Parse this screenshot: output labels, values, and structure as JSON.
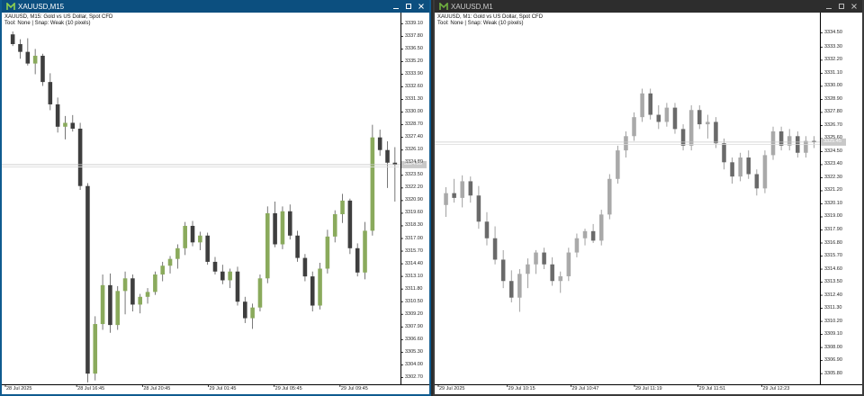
{
  "windows": [
    {
      "id": "left",
      "title": "XAUUSD,M15",
      "symbol_line": "XAUUSD, M15:  Gold vs US Dollar, Spot CFD",
      "tool_line": "Tool: None | Snap: Weak (10 pixels)",
      "active": true,
      "colors": {
        "up": "#8aaa5c",
        "down": "#3e3e3e",
        "wick": "#555555"
      },
      "current_price_label": "3324.55",
      "chart_data": {
        "type": "candlestick",
        "y_ticks": [
          "3339.10",
          "3337.80",
          "3336.50",
          "3335.20",
          "3333.90",
          "3332.60",
          "3331.30",
          "3330.00",
          "3328.70",
          "3327.40",
          "3326.10",
          "3324.80",
          "3323.50",
          "3322.20",
          "3320.90",
          "3319.60",
          "3318.30",
          "3317.00",
          "3315.70",
          "3314.40",
          "3313.10",
          "3311.80",
          "3310.50",
          "3309.20",
          "3307.90",
          "3306.60",
          "3305.30",
          "3304.00",
          "3302.70"
        ],
        "ylim": [
          3302.0,
          3339.5
        ],
        "x_ticks": [
          "28 Jul 2025",
          "28 Jul 16:45",
          "28 Jul 20:45",
          "29 Jul 01:45",
          "29 Jul 05:45",
          "29 Jul 09:45"
        ],
        "current_price": 3324.6,
        "candles": [
          [
            3338.0,
            3338.3,
            3336.8,
            3337.0
          ],
          [
            3337.0,
            3337.5,
            3335.5,
            3336.2
          ],
          [
            3336.2,
            3337.6,
            3334.8,
            3335.0
          ],
          [
            3335.0,
            3336.5,
            3333.9,
            3335.8
          ],
          [
            3335.8,
            3336.0,
            3332.7,
            3333.1
          ],
          [
            3333.1,
            3334.0,
            3330.2,
            3330.8
          ],
          [
            3330.8,
            3331.5,
            3327.9,
            3328.5
          ],
          [
            3328.5,
            3329.6,
            3327.2,
            3328.9
          ],
          [
            3328.9,
            3329.7,
            3328.0,
            3328.3
          ],
          [
            3328.3,
            3328.9,
            3322.0,
            3322.4
          ],
          [
            3322.4,
            3322.7,
            3302.2,
            3303.1
          ],
          [
            3303.1,
            3309.0,
            3302.4,
            3308.2
          ],
          [
            3308.2,
            3313.3,
            3307.6,
            3312.2
          ],
          [
            3312.2,
            3313.4,
            3307.3,
            3308.1
          ],
          [
            3308.1,
            3312.1,
            3307.6,
            3311.6
          ],
          [
            3311.6,
            3313.6,
            3309.2,
            3312.9
          ],
          [
            3312.9,
            3313.3,
            3309.5,
            3310.2
          ],
          [
            3310.2,
            3311.3,
            3309.3,
            3311.0
          ],
          [
            3311.0,
            3311.9,
            3310.3,
            3311.5
          ],
          [
            3311.5,
            3313.6,
            3311.2,
            3313.3
          ],
          [
            3313.3,
            3314.6,
            3312.6,
            3314.2
          ],
          [
            3314.2,
            3315.2,
            3313.4,
            3314.9
          ],
          [
            3314.9,
            3316.4,
            3313.9,
            3316.0
          ],
          [
            3316.0,
            3318.7,
            3315.3,
            3318.3
          ],
          [
            3318.3,
            3318.8,
            3316.2,
            3316.6
          ],
          [
            3316.6,
            3317.7,
            3315.8,
            3317.3
          ],
          [
            3317.3,
            3317.6,
            3314.3,
            3314.6
          ],
          [
            3314.6,
            3315.1,
            3313.3,
            3313.6
          ],
          [
            3313.6,
            3314.3,
            3312.3,
            3312.7
          ],
          [
            3312.7,
            3313.9,
            3311.9,
            3313.6
          ],
          [
            3313.6,
            3314.1,
            3310.1,
            3310.5
          ],
          [
            3310.5,
            3311.0,
            3308.3,
            3308.8
          ],
          [
            3308.8,
            3310.3,
            3307.7,
            3309.9
          ],
          [
            3309.9,
            3313.3,
            3309.5,
            3312.9
          ],
          [
            3312.9,
            3320.3,
            3312.4,
            3319.6
          ],
          [
            3319.6,
            3320.8,
            3316.1,
            3316.4
          ],
          [
            3316.4,
            3320.3,
            3315.9,
            3319.8
          ],
          [
            3319.8,
            3320.5,
            3316.9,
            3317.3
          ],
          [
            3317.3,
            3317.8,
            3314.6,
            3315.0
          ],
          [
            3315.0,
            3315.4,
            3312.6,
            3313.1
          ],
          [
            3313.1,
            3313.6,
            3309.5,
            3310.1
          ],
          [
            3310.1,
            3314.5,
            3309.7,
            3313.9
          ],
          [
            3313.9,
            3317.9,
            3313.4,
            3317.2
          ],
          [
            3317.2,
            3319.9,
            3316.6,
            3319.5
          ],
          [
            3319.5,
            3321.6,
            3318.6,
            3320.9
          ],
          [
            3320.9,
            3321.1,
            3315.4,
            3316.0
          ],
          [
            3316.0,
            3316.5,
            3313.1,
            3313.5
          ],
          [
            3313.5,
            3318.7,
            3312.8,
            3317.8
          ],
          [
            3317.8,
            3328.7,
            3317.3,
            3327.4
          ],
          [
            3327.4,
            3328.2,
            3325.5,
            3326.1
          ],
          [
            3326.1,
            3327.0,
            3322.2,
            3324.8
          ],
          [
            3324.8,
            3326.4,
            3320.8,
            3324.6
          ]
        ]
      }
    },
    {
      "id": "right",
      "title": "XAUUSD,M1",
      "symbol_line": "XAUUSD, M1:  Gold vs US Dollar, Spot CFD",
      "tool_line": "Tool: None | Snap: Weak (10 pixels)",
      "active": false,
      "colors": {
        "up": "#a9a9a9",
        "down": "#6a6a6a",
        "wick": "#8a8a8a"
      },
      "current_price_label": "3325.45",
      "chart_data": {
        "type": "candlestick",
        "y_ticks": [
          "3334.50",
          "3333.30",
          "3332.20",
          "3331.10",
          "3330.00",
          "3328.90",
          "3327.80",
          "3326.70",
          "3325.60",
          "3324.50",
          "3323.40",
          "3322.30",
          "3321.20",
          "3320.10",
          "3319.00",
          "3317.90",
          "3316.80",
          "3315.70",
          "3314.60",
          "3313.50",
          "3312.40",
          "3311.30",
          "3310.20",
          "3309.10",
          "3308.00",
          "3306.90",
          "3305.80"
        ],
        "ylim": [
          3304.9,
          3335.6
        ],
        "x_ticks": [
          "29 Jul 2025",
          "29 Jul 10:15",
          "29 Jul 10:47",
          "29 Jul 11:19",
          "29 Jul 11:51",
          "29 Jul 12:23"
        ],
        "current_price": 3325.3,
        "candles": [
          [
            3320.0,
            3321.5,
            3319.0,
            3321.0
          ],
          [
            3321.0,
            3322.2,
            3320.2,
            3320.6
          ],
          [
            3320.6,
            3322.5,
            3319.8,
            3322.0
          ],
          [
            3322.0,
            3322.4,
            3320.2,
            3320.8
          ],
          [
            3320.8,
            3321.6,
            3318.0,
            3318.6
          ],
          [
            3318.6,
            3319.4,
            3316.6,
            3317.2
          ],
          [
            3317.2,
            3318.2,
            3315.0,
            3315.4
          ],
          [
            3315.4,
            3316.2,
            3313.0,
            3313.6
          ],
          [
            3313.6,
            3314.5,
            3311.8,
            3312.2
          ],
          [
            3312.2,
            3314.6,
            3311.0,
            3314.2
          ],
          [
            3314.2,
            3315.5,
            3313.0,
            3315.0
          ],
          [
            3315.0,
            3316.2,
            3314.2,
            3316.0
          ],
          [
            3316.0,
            3316.4,
            3314.6,
            3315.0
          ],
          [
            3315.0,
            3315.6,
            3313.2,
            3313.6
          ],
          [
            3313.6,
            3314.4,
            3312.6,
            3314.0
          ],
          [
            3314.0,
            3316.4,
            3313.6,
            3316.0
          ],
          [
            3316.0,
            3317.6,
            3315.6,
            3317.2
          ],
          [
            3317.2,
            3318.0,
            3316.6,
            3317.8
          ],
          [
            3317.8,
            3318.4,
            3316.8,
            3317.0
          ],
          [
            3317.0,
            3319.6,
            3316.6,
            3319.2
          ],
          [
            3319.2,
            3322.6,
            3318.8,
            3322.2
          ],
          [
            3322.2,
            3325.0,
            3321.8,
            3324.6
          ],
          [
            3324.6,
            3326.2,
            3324.0,
            3325.8
          ],
          [
            3325.8,
            3327.8,
            3325.4,
            3327.4
          ],
          [
            3327.4,
            3329.8,
            3327.0,
            3329.4
          ],
          [
            3329.4,
            3329.8,
            3327.2,
            3327.6
          ],
          [
            3327.6,
            3328.4,
            3326.4,
            3327.0
          ],
          [
            3327.0,
            3328.6,
            3326.6,
            3328.2
          ],
          [
            3328.2,
            3328.6,
            3326.0,
            3326.4
          ],
          [
            3326.4,
            3326.8,
            3324.6,
            3325.0
          ],
          [
            3325.0,
            3328.4,
            3324.6,
            3328.0
          ],
          [
            3328.0,
            3328.4,
            3326.4,
            3326.8
          ],
          [
            3326.8,
            3327.6,
            3325.6,
            3327.0
          ],
          [
            3327.0,
            3327.4,
            3324.8,
            3325.2
          ],
          [
            3325.2,
            3325.6,
            3323.0,
            3323.6
          ],
          [
            3323.6,
            3324.0,
            3321.8,
            3322.4
          ],
          [
            3322.4,
            3324.4,
            3322.0,
            3324.0
          ],
          [
            3324.0,
            3324.6,
            3322.2,
            3322.6
          ],
          [
            3322.6,
            3323.0,
            3320.8,
            3321.4
          ],
          [
            3321.4,
            3324.6,
            3321.0,
            3324.2
          ],
          [
            3324.2,
            3326.6,
            3323.8,
            3326.2
          ],
          [
            3326.2,
            3326.6,
            3324.6,
            3325.0
          ],
          [
            3325.0,
            3326.4,
            3324.6,
            3325.8
          ],
          [
            3325.8,
            3326.2,
            3324.0,
            3324.4
          ],
          [
            3324.4,
            3325.8,
            3324.0,
            3325.4
          ],
          [
            3325.4,
            3325.8,
            3324.8,
            3325.3
          ]
        ]
      }
    }
  ]
}
